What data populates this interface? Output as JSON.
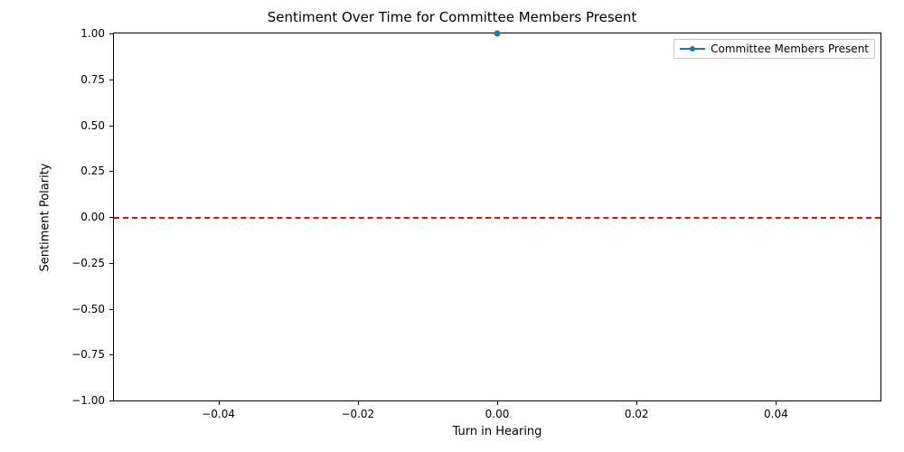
{
  "chart_data": {
    "type": "line",
    "title": "Sentiment Over Time for Committee Members Present",
    "xlabel": "Turn in Hearing",
    "ylabel": "Sentiment Polarity",
    "xlim": [
      -0.055,
      0.055
    ],
    "ylim": [
      -1.0,
      1.0
    ],
    "xticks": [
      -0.04,
      -0.02,
      0.0,
      0.02,
      0.04
    ],
    "xtick_labels": [
      "−0.04",
      "−0.02",
      "0.00",
      "0.02",
      "0.04"
    ],
    "yticks": [
      -1.0,
      -0.75,
      -0.5,
      -0.25,
      0.0,
      0.25,
      0.5,
      0.75,
      1.0
    ],
    "ytick_labels": [
      "−1.00",
      "−0.75",
      "−0.50",
      "−0.25",
      "0.00",
      "0.25",
      "0.50",
      "0.75",
      "1.00"
    ],
    "series": [
      {
        "name": "Committee Members Present",
        "color": "#1f77b4",
        "x": [
          0.0
        ],
        "y": [
          1.0
        ]
      }
    ],
    "reference_lines": [
      {
        "axis": "y",
        "value": 0.0,
        "color": "#ff0000",
        "style": "dashed"
      }
    ],
    "legend": {
      "position": "upper right",
      "entries": [
        "Committee Members Present"
      ]
    }
  }
}
